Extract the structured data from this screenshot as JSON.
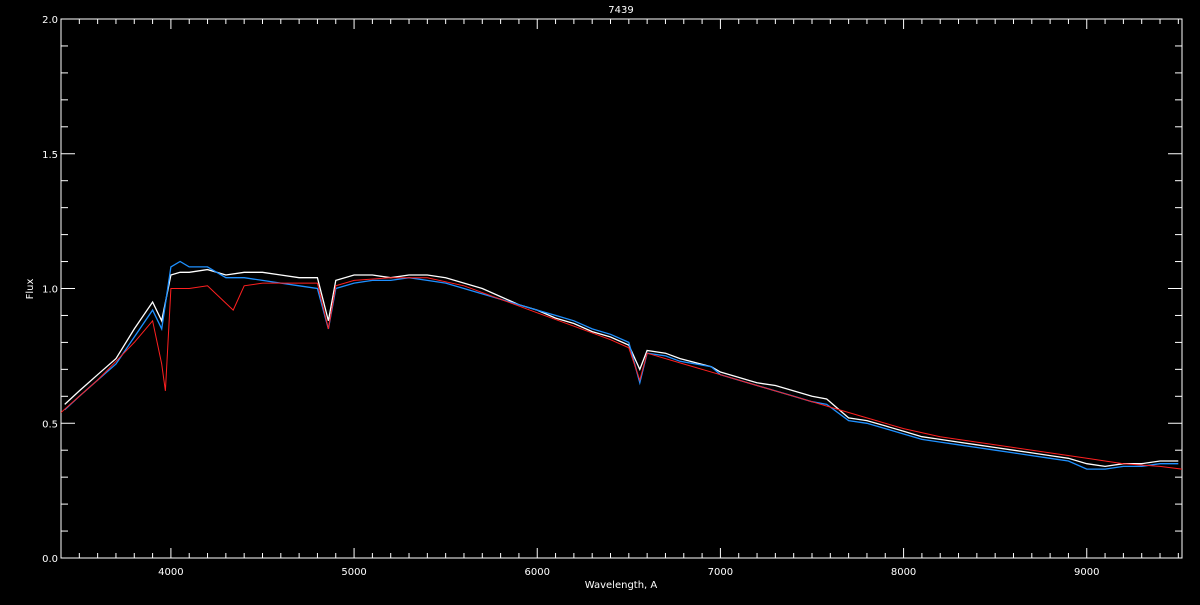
{
  "chart_data": {
    "type": "line",
    "title": "7439",
    "xlabel": "Wavelength, A",
    "ylabel": "Flux",
    "xlim": [
      3400,
      9520
    ],
    "ylim": [
      0.0,
      2.0
    ],
    "x_ticks": [
      4000,
      5000,
      6000,
      7000,
      8000,
      9000
    ],
    "x_tick_labels": [
      "4000",
      "5000",
      "6000",
      "7000",
      "8000",
      "9000"
    ],
    "y_ticks": [
      0.0,
      0.5,
      1.0,
      1.5,
      2.0
    ],
    "y_tick_labels": [
      "0.0",
      "0.5",
      "1.0",
      "1.5",
      "2.0"
    ],
    "grid": false,
    "background": "#000000",
    "series": [
      {
        "color": "#ffffff",
        "role": "observed spectrum",
        "x": [
          3420,
          3500,
          3600,
          3700,
          3800,
          3900,
          3950,
          4000,
          4050,
          4100,
          4200,
          4300,
          4400,
          4500,
          4600,
          4700,
          4800,
          4860,
          4900,
          5000,
          5100,
          5200,
          5300,
          5400,
          5500,
          5600,
          5700,
          5800,
          5900,
          6000,
          6100,
          6200,
          6300,
          6400,
          6500,
          6560,
          6600,
          6700,
          6780,
          6950,
          7000,
          7100,
          7200,
          7300,
          7400,
          7500,
          7580,
          7700,
          7800,
          7900,
          8000,
          8100,
          8200,
          8300,
          8400,
          8500,
          8600,
          8700,
          8800,
          8900,
          9000,
          9100,
          9200,
          9300,
          9400,
          9500
        ],
        "y": [
          0.57,
          0.62,
          0.68,
          0.74,
          0.85,
          0.95,
          0.88,
          1.05,
          1.06,
          1.06,
          1.07,
          1.05,
          1.06,
          1.06,
          1.05,
          1.04,
          1.04,
          0.88,
          1.03,
          1.05,
          1.05,
          1.04,
          1.05,
          1.05,
          1.04,
          1.02,
          1.0,
          0.97,
          0.94,
          0.92,
          0.89,
          0.87,
          0.84,
          0.82,
          0.79,
          0.7,
          0.77,
          0.76,
          0.74,
          0.71,
          0.69,
          0.67,
          0.65,
          0.64,
          0.62,
          0.6,
          0.59,
          0.52,
          0.51,
          0.49,
          0.47,
          0.45,
          0.44,
          0.43,
          0.42,
          0.41,
          0.4,
          0.39,
          0.38,
          0.37,
          0.35,
          0.34,
          0.35,
          0.35,
          0.36,
          0.36
        ]
      },
      {
        "color": "#1e90ff",
        "role": "comparison spectrum",
        "x": [
          3420,
          3500,
          3600,
          3700,
          3800,
          3900,
          3950,
          4000,
          4050,
          4100,
          4200,
          4300,
          4400,
          4500,
          4600,
          4700,
          4800,
          4860,
          4900,
          5000,
          5100,
          5200,
          5300,
          5400,
          5500,
          5600,
          5700,
          5800,
          5900,
          6000,
          6100,
          6200,
          6300,
          6400,
          6500,
          6560,
          6600,
          6700,
          6780,
          6950,
          7000,
          7100,
          7200,
          7300,
          7400,
          7500,
          7580,
          7700,
          7800,
          7900,
          8000,
          8100,
          8200,
          8300,
          8400,
          8500,
          8600,
          8700,
          8800,
          8900,
          9000,
          9100,
          9200,
          9300,
          9400,
          9500
        ],
        "y": [
          0.55,
          0.6,
          0.66,
          0.72,
          0.82,
          0.92,
          0.85,
          1.08,
          1.1,
          1.08,
          1.08,
          1.04,
          1.04,
          1.03,
          1.02,
          1.01,
          1.0,
          0.85,
          1.0,
          1.02,
          1.03,
          1.03,
          1.04,
          1.03,
          1.02,
          1.0,
          0.98,
          0.96,
          0.94,
          0.92,
          0.9,
          0.88,
          0.85,
          0.83,
          0.8,
          0.65,
          0.76,
          0.75,
          0.73,
          0.71,
          0.68,
          0.66,
          0.64,
          0.62,
          0.6,
          0.58,
          0.57,
          0.51,
          0.5,
          0.48,
          0.46,
          0.44,
          0.43,
          0.42,
          0.41,
          0.4,
          0.39,
          0.38,
          0.37,
          0.36,
          0.33,
          0.33,
          0.34,
          0.34,
          0.35,
          0.35
        ]
      },
      {
        "color": "#ff2020",
        "role": "model continuum",
        "x": [
          3400,
          3500,
          3600,
          3700,
          3800,
          3900,
          3950,
          3970,
          4000,
          4100,
          4200,
          4340,
          4400,
          4500,
          4600,
          4700,
          4800,
          4860,
          4900,
          5000,
          5200,
          5400,
          5600,
          5800,
          6000,
          6200,
          6400,
          6500,
          6560,
          6600,
          6800,
          7000,
          7200,
          7400,
          7600,
          7800,
          8000,
          8200,
          8400,
          8600,
          8800,
          9000,
          9200,
          9400,
          9520
        ],
        "y": [
          0.54,
          0.6,
          0.66,
          0.73,
          0.8,
          0.88,
          0.72,
          0.62,
          1.0,
          1.0,
          1.01,
          0.92,
          1.01,
          1.02,
          1.02,
          1.02,
          1.02,
          0.85,
          1.01,
          1.03,
          1.04,
          1.04,
          1.01,
          0.96,
          0.91,
          0.86,
          0.81,
          0.78,
          0.66,
          0.76,
          0.72,
          0.68,
          0.64,
          0.6,
          0.56,
          0.52,
          0.48,
          0.45,
          0.43,
          0.41,
          0.39,
          0.37,
          0.35,
          0.34,
          0.33
        ]
      }
    ]
  }
}
